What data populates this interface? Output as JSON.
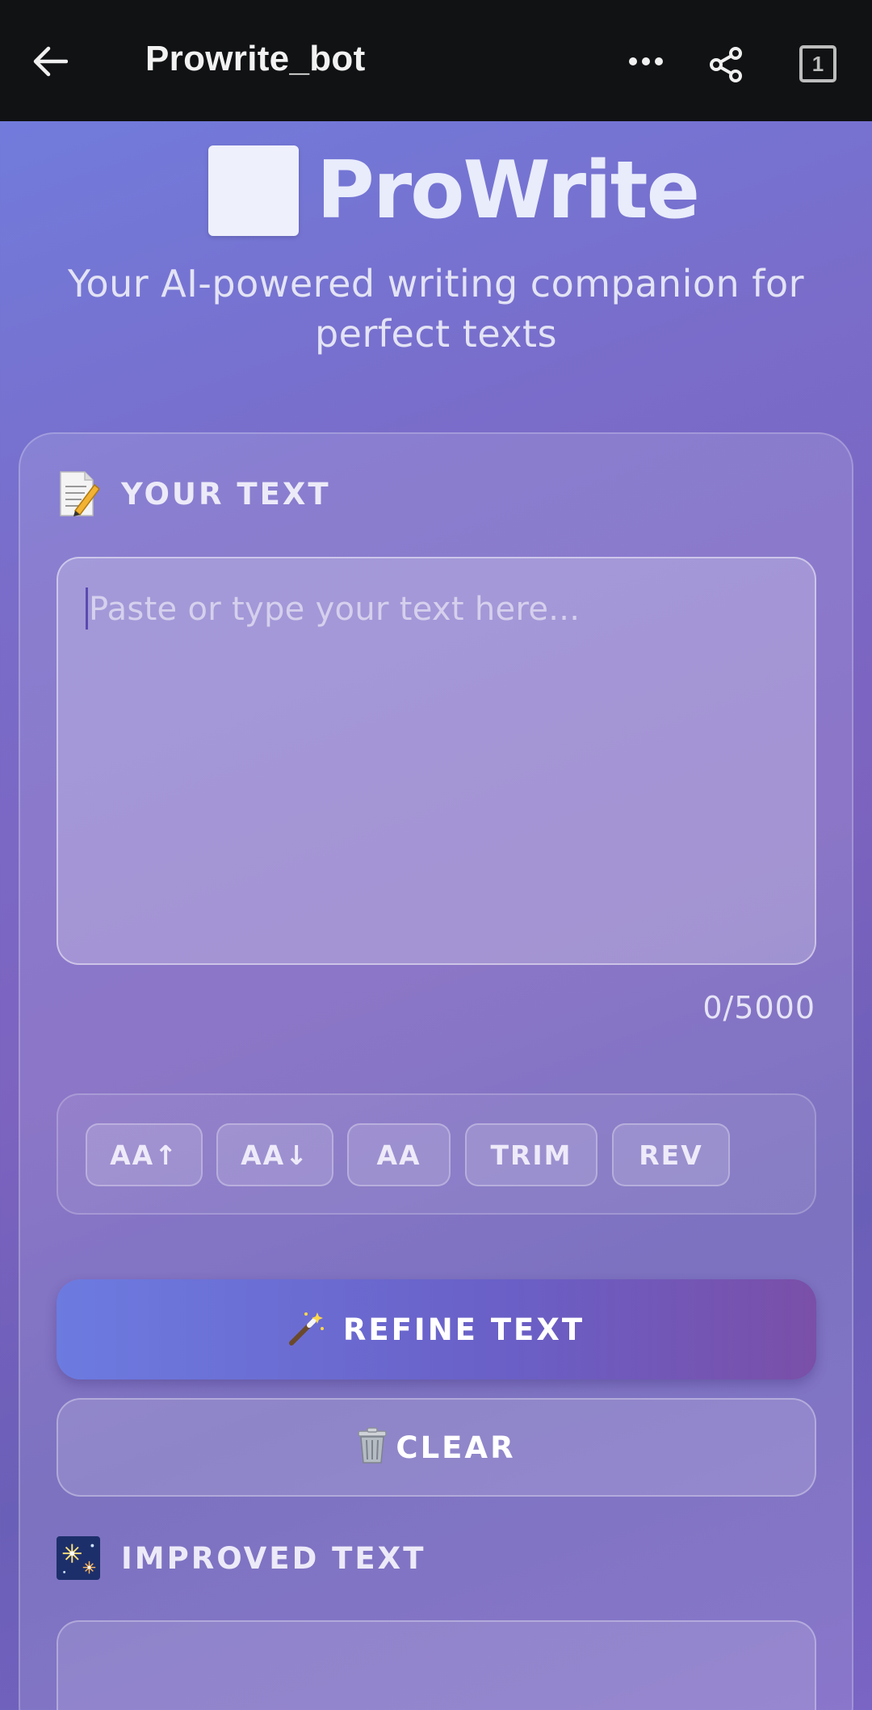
{
  "appbar": {
    "title": "Prowrite_bot",
    "tab_count": "1",
    "icons": [
      "back-arrow-icon",
      "more-dots-icon",
      "share-icon",
      "tabs-icon"
    ]
  },
  "hero": {
    "logo_text": "ProWrite",
    "tagline": "Your AI-powered writing companion for perfect texts"
  },
  "input_section": {
    "label": "YOUR TEXT",
    "icon": "memo-pencil-icon",
    "placeholder": "Paste or type your text here...",
    "value": "",
    "counter": "0/5000"
  },
  "tools": [
    {
      "label": "AA↑",
      "name": "uppercase-button"
    },
    {
      "label": "AA↓",
      "name": "lowercase-button"
    },
    {
      "label": "AA",
      "name": "titlecase-button"
    },
    {
      "label": "TRIM",
      "name": "trim-button"
    },
    {
      "label": "REV",
      "name": "reverse-button"
    }
  ],
  "actions": {
    "refine_label": "REFINE TEXT",
    "refine_icon": "magic-wand-icon",
    "clear_label": "CLEAR",
    "clear_icon": "trash-icon"
  },
  "output_section": {
    "label": "IMPROVED TEXT",
    "icon": "sparkler-icon"
  },
  "colors": {
    "appbar_bg": "#111214",
    "bg_start": "#6f7fe0",
    "bg_end": "#7a64c4",
    "refine_start": "#6c7be0",
    "refine_end": "#7a4fa8"
  }
}
